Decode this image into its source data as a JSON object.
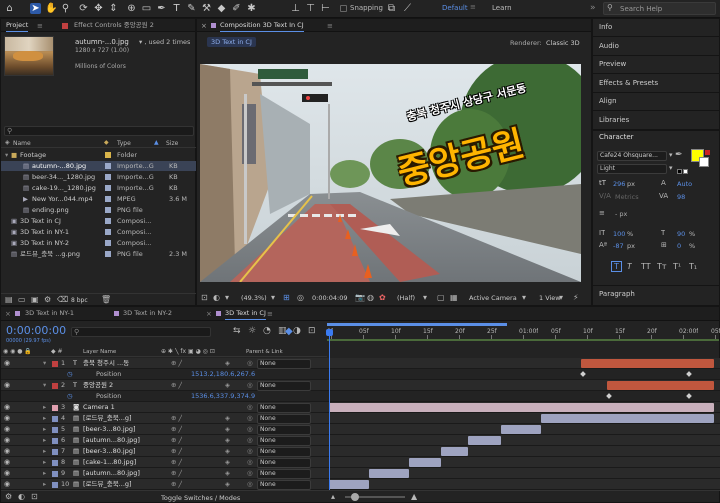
{
  "toolbar": {
    "snapping": "Snapping",
    "workspaces": [
      "Default",
      "Learn"
    ],
    "search_placeholder": "Search Help"
  },
  "project": {
    "tab_project": "Project",
    "tab_effects": "Effect Controls 중앙공원 2",
    "file_name": "autumn-...0.jpg",
    "used": "▾ , used 2 times",
    "dims": "1280 x 727 (1.00)",
    "colors": "Millions of Colors",
    "search_placeholder": "",
    "col_name": "Name",
    "col_type": "Type",
    "col_size": "Size",
    "bpc": "8 bpc",
    "items": [
      {
        "name": "Footage",
        "type": "Folder",
        "size": "",
        "color": "#d9b44a",
        "indent": 0,
        "icon": "folder-icon"
      },
      {
        "name": "autumn-...80.jpg",
        "type": "Importe...G",
        "size": "KB",
        "color": "#9aa8c8",
        "indent": 1,
        "icon": "image-file-icon",
        "selected": true
      },
      {
        "name": "beer-34..._1280.jpg",
        "type": "Importe...G",
        "size": "KB",
        "color": "#9aa8c8",
        "indent": 1,
        "icon": "image-file-icon"
      },
      {
        "name": "cake-19..._1280.jpg",
        "type": "Importe...G",
        "size": "KB",
        "color": "#9aa8c8",
        "indent": 1,
        "icon": "image-file-icon"
      },
      {
        "name": "New Yor...044.mp4",
        "type": "MPEG",
        "size": "3.6 M",
        "color": "#9aa8c8",
        "indent": 1,
        "icon": "video-file-icon"
      },
      {
        "name": "ending.png",
        "type": "PNG file",
        "size": "",
        "color": "#9aa8c8",
        "indent": 1,
        "icon": "image-file-icon"
      },
      {
        "name": "3D Text in CJ",
        "type": "Composi...",
        "size": "",
        "color": "#9aa8c8",
        "indent": 0,
        "icon": "composition-icon"
      },
      {
        "name": "3D Text in NY-1",
        "type": "Composi...",
        "size": "",
        "color": "#9aa8c8",
        "indent": 0,
        "icon": "composition-icon"
      },
      {
        "name": "3D Text in NY-2",
        "type": "Composi...",
        "size": "",
        "color": "#9aa8c8",
        "indent": 0,
        "icon": "composition-icon"
      },
      {
        "name": "로드뷰_충북 ...g.png",
        "type": "PNG file",
        "size": "2.3 M",
        "color": "#9aa8c8",
        "indent": 0,
        "icon": "image-file-icon"
      }
    ]
  },
  "comp": {
    "tab": "Composition 3D Text In CJ",
    "chip": "3D Text in CJ",
    "renderer_label": "Renderer:",
    "renderer": "Classic 3D",
    "zoom": "(49.3%)",
    "timecode": "0:00:04:09",
    "resolution": "(Half)",
    "camera": "Active Camera",
    "views": "1 View",
    "sign_text": "충북 청주시 상당구 서문동",
    "title_text": "중앙공원"
  },
  "right_panels": [
    "Info",
    "Audio",
    "Preview",
    "Effects & Presets",
    "Align",
    "Libraries"
  ],
  "character": {
    "title": "Character",
    "font": "Cafe24 Ohsquare...",
    "style": "Light",
    "size": "296",
    "size_unit": "px",
    "leading": "Auto",
    "kerning": "Metrics",
    "tracking": "98",
    "indent": "- px",
    "vscale": "100",
    "hscale": "90",
    "baseline": "-87",
    "baseline_unit": "px",
    "tsume": "0",
    "fill_color": "#ffff00",
    "paragraph": "Paragraph"
  },
  "timeline": {
    "tabs": [
      "3D Text in NY-1",
      "3D Text in NY-2",
      "3D Text in CJ"
    ],
    "timecode": "0:00:00:00",
    "fps": "00000 (29.97 fps)",
    "search_placeholder": "",
    "col_layer_name": "Layer Name",
    "col_parent": "Parent & Link",
    "ruler": [
      "0f",
      "05f",
      "10f",
      "15f",
      "20f",
      "25f",
      "01:00f",
      "05f",
      "10f",
      "15f",
      "20f",
      "02:00f",
      "05f"
    ],
    "toggle_label": "Toggle Switches / Modes",
    "layers": [
      {
        "num": "1",
        "name": "충북 청주시 ...동",
        "icon": "text-layer-icon",
        "color": "#c04040",
        "parent": "None",
        "bar_start": 580,
        "bar_end": 713,
        "bar_color": "#c0573e"
      },
      {
        "num": "",
        "name": "Position",
        "icon": "stopwatch-icon",
        "value": "1513.2,180.6,267.6",
        "prop": true
      },
      {
        "num": "2",
        "name": "중앙공원 2",
        "icon": "text-layer-icon",
        "color": "#c04040",
        "parent": "None",
        "bar_start": 606,
        "bar_end": 713,
        "bar_color": "#c0573e"
      },
      {
        "num": "",
        "name": "Position",
        "icon": "stopwatch-icon",
        "value": "1536.6,337.9,374.9",
        "prop": true
      },
      {
        "num": "3",
        "name": "Camera 1",
        "icon": "camera-layer-icon",
        "color": "#e0a0b0",
        "parent": "None",
        "bar_start": 328,
        "bar_end": 713,
        "bar_color": "#c9b0bc"
      },
      {
        "num": "4",
        "name": "[로드뷰_충북...g]",
        "icon": "image-layer-icon",
        "color": "#8090c0",
        "parent": "None",
        "bar_start": 540,
        "bar_end": 713,
        "bar_color": "#9ea3c0"
      },
      {
        "num": "5",
        "name": "[beer-3...80.jpg]",
        "icon": "image-layer-icon",
        "color": "#8090c0",
        "parent": "None",
        "bar_start": 500,
        "bar_end": 540,
        "bar_color": "#9ea3c0"
      },
      {
        "num": "6",
        "name": "[autumn...80.jpg]",
        "icon": "image-layer-icon",
        "color": "#8090c0",
        "parent": "None",
        "bar_start": 467,
        "bar_end": 500,
        "bar_color": "#9ea3c0"
      },
      {
        "num": "7",
        "name": "[beer-3...80.jpg]",
        "icon": "image-layer-icon",
        "color": "#8090c0",
        "parent": "None",
        "bar_start": 440,
        "bar_end": 467,
        "bar_color": "#9ea3c0"
      },
      {
        "num": "8",
        "name": "[cake-1...80.jpg]",
        "icon": "image-layer-icon",
        "color": "#8090c0",
        "parent": "None",
        "bar_start": 408,
        "bar_end": 440,
        "bar_color": "#9ea3c0"
      },
      {
        "num": "9",
        "name": "[autumn...80.jpg]",
        "icon": "image-layer-icon",
        "color": "#8090c0",
        "parent": "None",
        "bar_start": 368,
        "bar_end": 408,
        "bar_color": "#9ea3c0"
      },
      {
        "num": "10",
        "name": "[로드뷰_충북...g]",
        "icon": "image-layer-icon",
        "color": "#8090c0",
        "parent": "None",
        "bar_start": 328,
        "bar_end": 368,
        "bar_color": "#9ea3c0"
      }
    ]
  }
}
